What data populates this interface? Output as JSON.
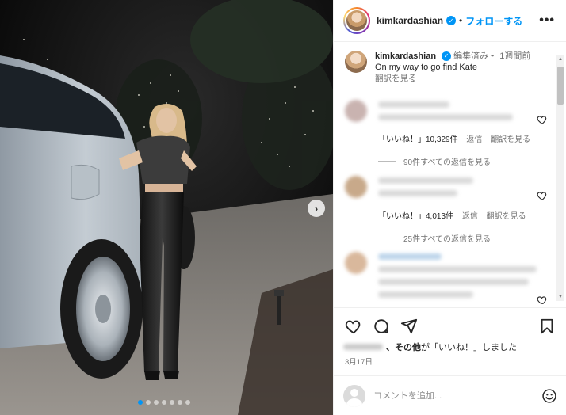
{
  "header": {
    "username": "kimkardashian",
    "separator": "•",
    "follow_label": "フォローする",
    "more_label": "•••"
  },
  "caption": {
    "username": "kimkardashian",
    "meta": "編集済み・ 1週間前",
    "text": "On my way to go find Kate",
    "see_translation": "翻訳を見る"
  },
  "comments": [
    {
      "likes": "「いいね！」10,329件",
      "reply": "返信",
      "translate": "翻訳を見る",
      "view_replies": "90件すべての返信を見る"
    },
    {
      "likes": "「いいね！」4,013件",
      "reply": "返信",
      "translate": "翻訳を見る",
      "view_replies": "25件すべての返信を見る"
    }
  ],
  "liked_by": {
    "others": "、その他",
    "suffix": "が「いいね！」しました"
  },
  "date": "3月17日",
  "add_comment": {
    "placeholder": "コメントを追加..."
  },
  "icons": {
    "verified": "verified-badge-icon",
    "like": "heart-icon",
    "comment": "comment-bubble-icon",
    "share": "paper-plane-icon",
    "save": "bookmark-icon",
    "emoji": "smiley-icon",
    "next": "chevron-right-icon"
  },
  "colors": {
    "accent": "#0095f6",
    "text": "#262626",
    "muted": "#737373"
  },
  "carousel": {
    "next_label": "›",
    "slides": 7,
    "active_index": 0
  }
}
